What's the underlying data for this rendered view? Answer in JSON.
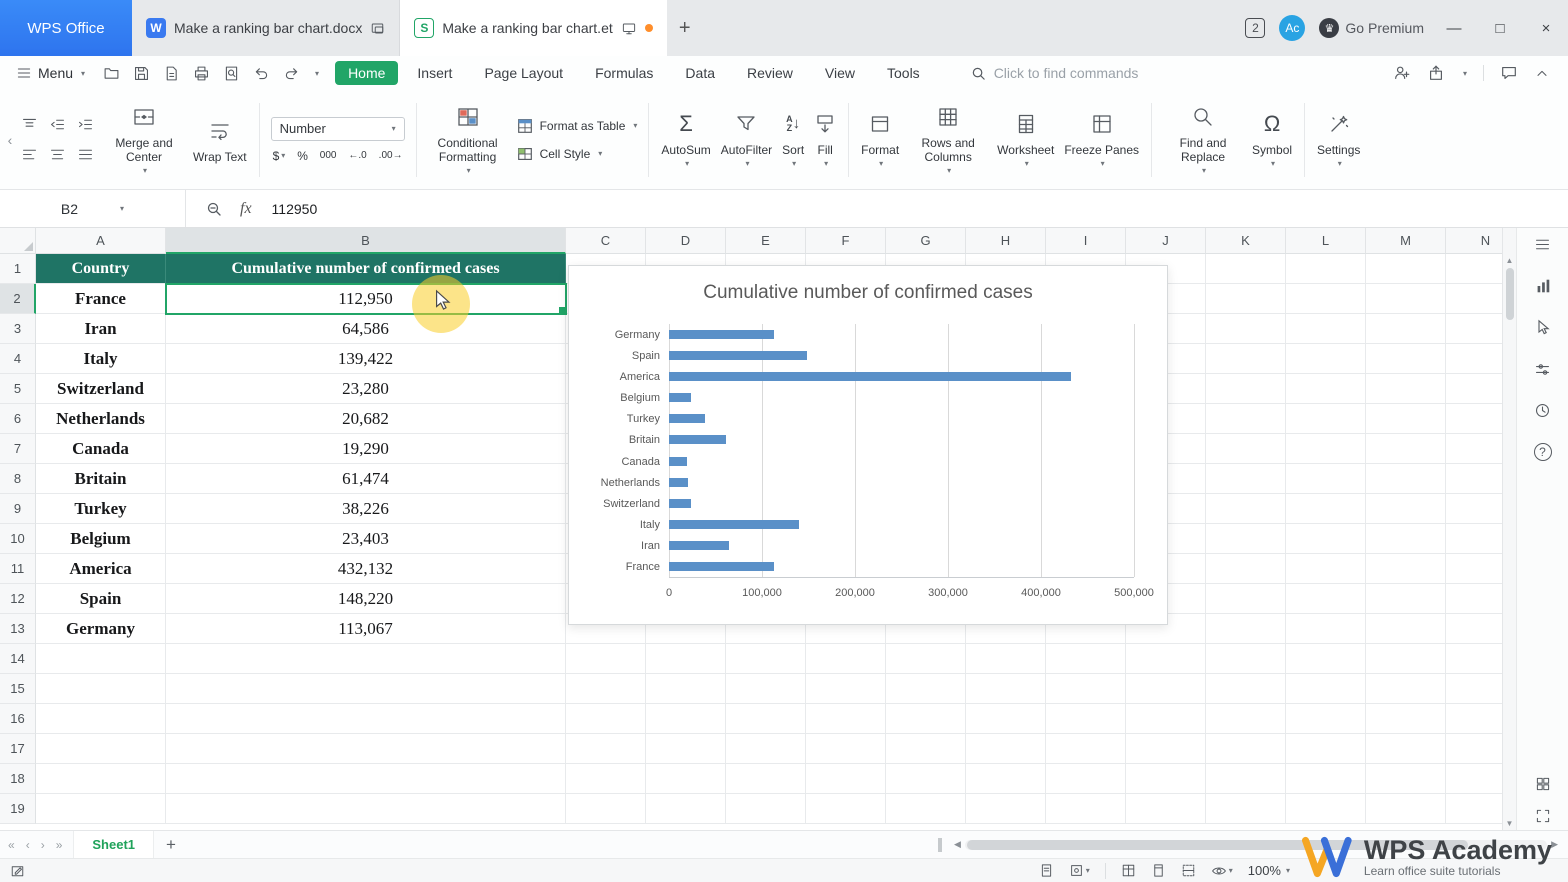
{
  "titlebar": {
    "app_button": "WPS Office",
    "tabs": [
      {
        "title": "Make a ranking bar chart.docx",
        "type": "writer"
      },
      {
        "title": "Make a ranking bar chart.et",
        "type": "spreadsheet",
        "active": true
      }
    ],
    "window_badge": "2",
    "avatar_text": "Ac",
    "premium_label": "Go Premium"
  },
  "menubar": {
    "menu_label": "Menu",
    "tabs": [
      "Home",
      "Insert",
      "Page Layout",
      "Formulas",
      "Data",
      "Review",
      "View",
      "Tools"
    ],
    "active_tab": "Home",
    "search_placeholder": "Click to find commands"
  },
  "toolbar": {
    "merge_center": "Merge and Center",
    "wrap_text": "Wrap Text",
    "number_format": "Number",
    "currency": "$",
    "percent": "%",
    "thousands": "000",
    "dec_dec": "←.0",
    "dec_inc": ".00→",
    "conditional_formatting": "Conditional Formatting",
    "format_as_table": "Format as Table",
    "cell_style": "Cell Style",
    "autosum": "AutoSum",
    "autofilter": "AutoFilter",
    "sort": "Sort",
    "fill": "Fill",
    "format": "Format",
    "rows_and_columns": "Rows and Columns",
    "worksheet": "Worksheet",
    "freeze_panes": "Freeze Panes",
    "find_replace": "Find and Replace",
    "symbol": "Symbol",
    "settings": "Settings"
  },
  "formula_bar": {
    "cell_ref": "B2",
    "value": "112950"
  },
  "icons": {
    "sum": "Σ",
    "omega": "Ω",
    "fx": "fx",
    "sort_a": "A",
    "sort_z": "Z",
    "writer_badge": "W",
    "et_badge": "S",
    "help": "?",
    "plus": "+",
    "premium_crown": "♛"
  },
  "sheet": {
    "columns": [
      "A",
      "B",
      "C",
      "D",
      "E",
      "F",
      "G",
      "H",
      "I",
      "J",
      "K",
      "L",
      "M",
      "N"
    ],
    "visible_rows": 19,
    "selected": {
      "col": "B",
      "row": 2
    },
    "header": {
      "country": "Country",
      "cases": "Cumulative number of confirmed cases"
    },
    "data": [
      {
        "row": 2,
        "country": "France",
        "cases": "112,950"
      },
      {
        "row": 3,
        "country": "Iran",
        "cases": "64,586"
      },
      {
        "row": 4,
        "country": "Italy",
        "cases": "139,422"
      },
      {
        "row": 5,
        "country": "Switzerland",
        "cases": "23,280"
      },
      {
        "row": 6,
        "country": "Netherlands",
        "cases": "20,682"
      },
      {
        "row": 7,
        "country": "Canada",
        "cases": "19,290"
      },
      {
        "row": 8,
        "country": "Britain",
        "cases": "61,474"
      },
      {
        "row": 9,
        "country": "Turkey",
        "cases": "38,226"
      },
      {
        "row": 10,
        "country": "Belgium",
        "cases": "23,403"
      },
      {
        "row": 11,
        "country": "America",
        "cases": "432,132"
      },
      {
        "row": 12,
        "country": "Spain",
        "cases": "148,220"
      },
      {
        "row": 13,
        "country": "Germany",
        "cases": "113,067"
      }
    ]
  },
  "chart_data": {
    "type": "bar",
    "orientation": "horizontal",
    "title": "Cumulative number of confirmed cases",
    "categories": [
      "Germany",
      "Spain",
      "America",
      "Belgium",
      "Turkey",
      "Britain",
      "Canada",
      "Netherlands",
      "Switzerland",
      "Italy",
      "Iran",
      "France"
    ],
    "values": [
      113067,
      148220,
      432132,
      23403,
      38226,
      61474,
      19290,
      20682,
      23280,
      139422,
      64586,
      112950
    ],
    "xlim": [
      0,
      500000
    ],
    "x_ticks": [
      "0",
      "100,000",
      "200,000",
      "300,000",
      "400,000",
      "500,000"
    ],
    "grid": true,
    "legend": false,
    "bar_color": "#5a90c8"
  },
  "sheet_tabs": {
    "active": "Sheet1"
  },
  "status_bar": {
    "zoom": "100%"
  },
  "watermark": {
    "title": "WPS Academy",
    "subtitle": "Learn office suite tutorials"
  },
  "colors": {
    "accent_green": "#21a567",
    "header_teal": "#1f7465",
    "bar_blue": "#5a90c8",
    "wps_blue": "#2e74ee",
    "unsaved_orange": "#ff8e2b"
  }
}
